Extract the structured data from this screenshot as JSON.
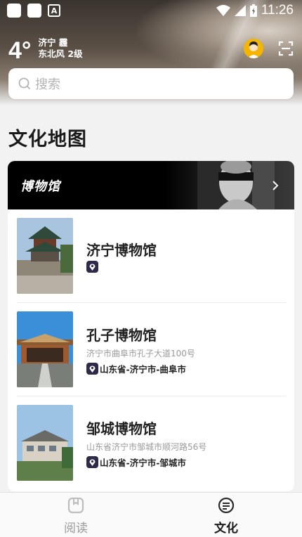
{
  "status_bar": {
    "time": "11:26"
  },
  "weather": {
    "temp": "4°",
    "city_line": "济宁 霾",
    "wind_line": "东北风 2级"
  },
  "search": {
    "placeholder": "搜索"
  },
  "page_title": "文化地图",
  "banner": {
    "title": "博物馆"
  },
  "museums": [
    {
      "name": "济宁博物馆",
      "address": "",
      "region": ""
    },
    {
      "name": "孔子博物馆",
      "address": "济宁市曲阜市孔子大道100号",
      "region": "山东省-济宁市-曲阜市"
    },
    {
      "name": "邹城博物馆",
      "address": "山东省济宁市邹城市顺河路56号",
      "region": "山东省-济宁市-邹城市"
    }
  ],
  "tabs": [
    {
      "label": "阅读",
      "active": false
    },
    {
      "label": "文化",
      "active": true
    }
  ],
  "colors": {
    "accent": "#2d2a4a",
    "avatar": "#f4b400"
  }
}
